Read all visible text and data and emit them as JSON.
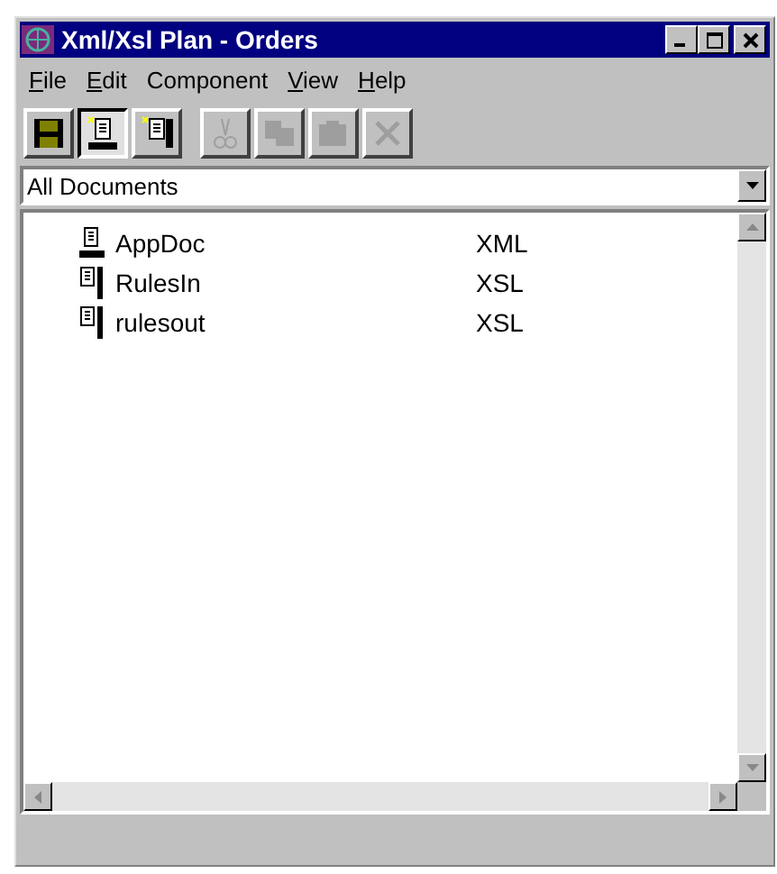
{
  "window": {
    "title": "Xml/Xsl Plan - Orders"
  },
  "menu": [
    {
      "label": "File",
      "underlined": true
    },
    {
      "label": "Edit",
      "underlined": true
    },
    {
      "label": "Component",
      "underlined": false
    },
    {
      "label": "View",
      "underlined": true
    },
    {
      "label": "Help",
      "underlined": true
    }
  ],
  "toolbar": [
    {
      "kind": "save",
      "disabled": false,
      "pressed": false
    },
    {
      "kind": "new-xml",
      "disabled": false,
      "pressed": true
    },
    {
      "kind": "new-xsl",
      "disabled": false,
      "pressed": false
    },
    {
      "kind": "cut",
      "disabled": true,
      "pressed": false
    },
    {
      "kind": "copy",
      "disabled": true,
      "pressed": false
    },
    {
      "kind": "paste",
      "disabled": true,
      "pressed": false
    },
    {
      "kind": "delete",
      "disabled": true,
      "pressed": false
    }
  ],
  "filter": {
    "value": "All Documents"
  },
  "documents": [
    {
      "kind": "xml",
      "name": "AppDoc",
      "type": "XML"
    },
    {
      "kind": "xsl",
      "name": "RulesIn",
      "type": "XSL"
    },
    {
      "kind": "xsl",
      "name": "rulesout",
      "type": "XSL"
    }
  ]
}
